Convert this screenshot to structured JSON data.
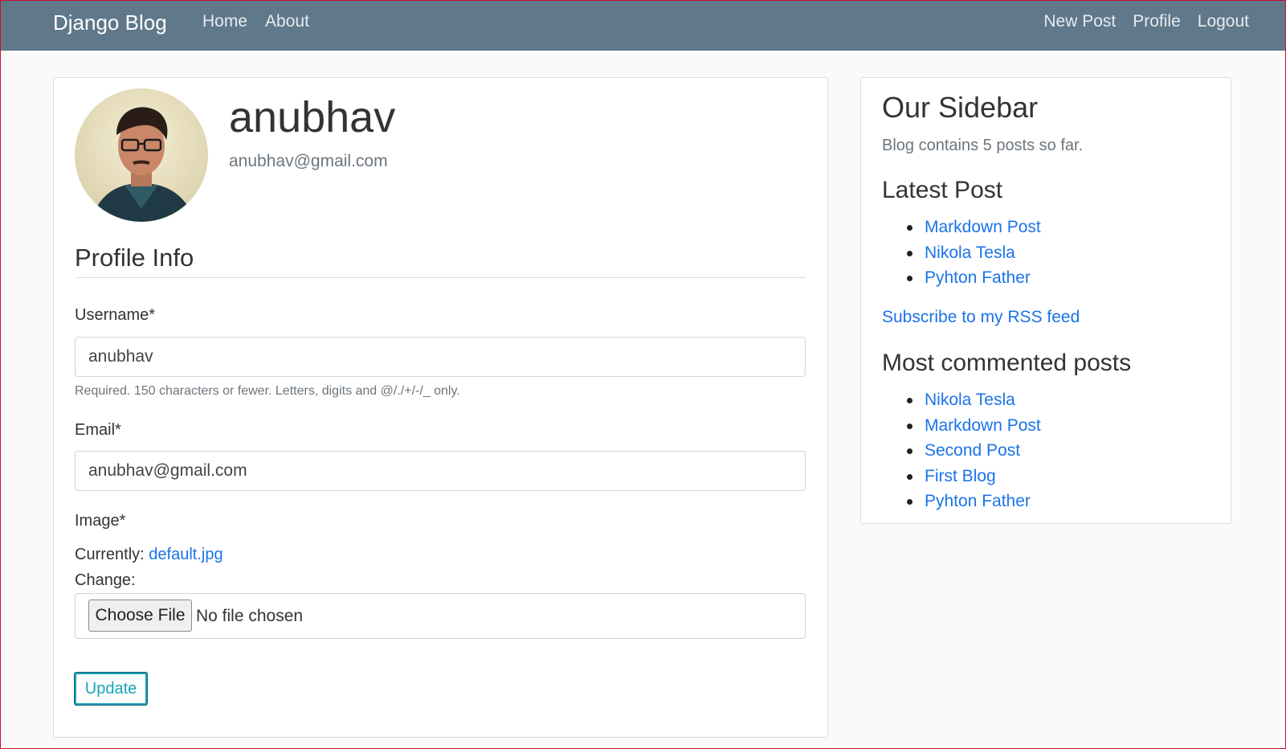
{
  "navbar": {
    "brand": "Django Blog",
    "left_links": [
      "Home",
      "About"
    ],
    "right_links": [
      "New Post",
      "Profile",
      "Logout"
    ]
  },
  "profile": {
    "username": "anubhav",
    "email": "anubhav@gmail.com"
  },
  "form": {
    "section_title": "Profile Info",
    "username_label": "Username*",
    "username_value": "anubhav",
    "username_help": "Required. 150 characters or fewer. Letters, digits and @/./+/-/_ only.",
    "email_label": "Email*",
    "email_value": "anubhav@gmail.com",
    "image_label": "Image*",
    "currently_label": "Currently:",
    "current_file": "default.jpg",
    "change_label": "Change:",
    "choose_file_label": "Choose File",
    "no_file_text": "No file chosen",
    "update_label": "Update"
  },
  "sidebar": {
    "title": "Our Sidebar",
    "post_count_text": "Blog contains 5 posts so far.",
    "latest_title": "Latest Post",
    "latest_posts": [
      "Markdown Post",
      "Nikola Tesla",
      "Pyhton Father"
    ],
    "rss_link": "Subscribe to my RSS feed",
    "most_commented_title": "Most commented posts",
    "most_commented_posts": [
      "Nikola Tesla",
      "Markdown Post",
      "Second Post",
      "First Blog",
      "Pyhton Father"
    ]
  },
  "colors": {
    "navbar_bg": "#5f788a",
    "link": "#1a73e8",
    "update_button": "#17a2b8"
  }
}
